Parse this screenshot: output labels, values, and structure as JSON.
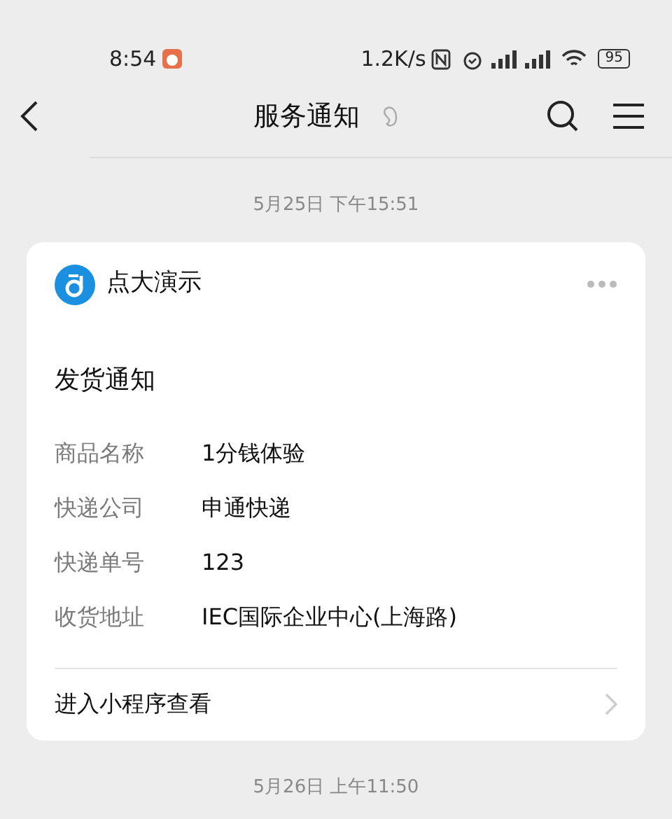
{
  "status_bar": {
    "time": "8:54",
    "speed": "1.2K/s",
    "battery": "95"
  },
  "nav": {
    "title": "服务通知"
  },
  "messages": [
    {
      "timestamp": "5月25日 下午15:51",
      "sender": "点大演示",
      "title": "发货通知",
      "fields": [
        {
          "label": "商品名称",
          "value": "1分钱体验"
        },
        {
          "label": "快递公司",
          "value": "申通快递"
        },
        {
          "label": "快递单号",
          "value": "123"
        },
        {
          "label": "收货地址",
          "value": "IEC国际企业中心(上海路)"
        }
      ],
      "link": "进入小程序查看"
    }
  ],
  "next_timestamp": "5月26日 上午11:50"
}
